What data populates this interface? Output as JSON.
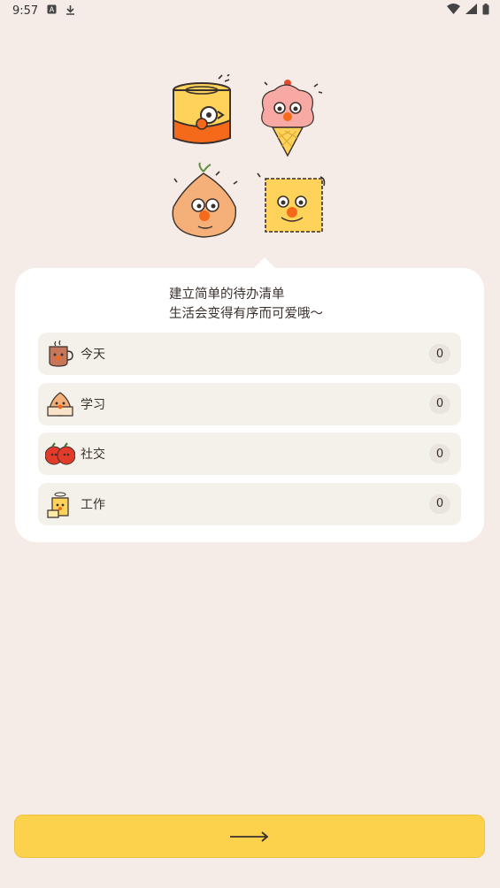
{
  "status_bar": {
    "time": "9:57",
    "left_icons": [
      "a-notification-icon",
      "download-icon"
    ],
    "right_icons": [
      "wifi-icon",
      "signal-icon",
      "battery-icon"
    ]
  },
  "intro": {
    "line1": "建立简单的待办清单",
    "line2": "生活会变得有序而可爱哦～"
  },
  "lists": [
    {
      "label": "今天",
      "count": "0",
      "icon": "cup-character-icon"
    },
    {
      "label": "学习",
      "count": "0",
      "icon": "dumpling-character-icon"
    },
    {
      "label": "社交",
      "count": "0",
      "icon": "tomatoes-character-icon"
    },
    {
      "label": "工作",
      "count": "0",
      "icon": "cheese-character-icon"
    }
  ],
  "next_button": {
    "icon": "arrow-right-icon"
  },
  "colors": {
    "background": "#F5EBE7",
    "card": "#FFFFFF",
    "row": "#F4F0EA",
    "accent_button": "#FCD14C"
  }
}
